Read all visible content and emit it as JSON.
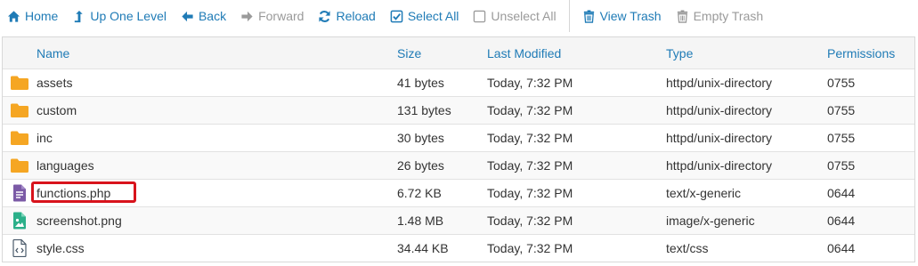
{
  "toolbar": {
    "home": "Home",
    "up_one_level": "Up One Level",
    "back": "Back",
    "forward": "Forward",
    "reload": "Reload",
    "select_all": "Select All",
    "unselect_all": "Unselect All",
    "view_trash": "View Trash",
    "empty_trash": "Empty Trash"
  },
  "table": {
    "headers": {
      "name": "Name",
      "size": "Size",
      "modified": "Last Modified",
      "type": "Type",
      "permissions": "Permissions"
    },
    "rows": [
      {
        "icon": "folder-icon",
        "name": "assets",
        "size": "41 bytes",
        "modified": "Today, 7:32 PM",
        "type": "httpd/unix-directory",
        "perm": "0755"
      },
      {
        "icon": "folder-icon",
        "name": "custom",
        "size": "131 bytes",
        "modified": "Today, 7:32 PM",
        "type": "httpd/unix-directory",
        "perm": "0755"
      },
      {
        "icon": "folder-icon",
        "name": "inc",
        "size": "30 bytes",
        "modified": "Today, 7:32 PM",
        "type": "httpd/unix-directory",
        "perm": "0755"
      },
      {
        "icon": "folder-icon",
        "name": "languages",
        "size": "26 bytes",
        "modified": "Today, 7:32 PM",
        "type": "httpd/unix-directory",
        "perm": "0755"
      },
      {
        "icon": "text-file-icon",
        "name": "functions.php",
        "size": "6.72 KB",
        "modified": "Today, 7:32 PM",
        "type": "text/x-generic",
        "perm": "0644"
      },
      {
        "icon": "image-file-icon",
        "name": "screenshot.png",
        "size": "1.48 MB",
        "modified": "Today, 7:32 PM",
        "type": "image/x-generic",
        "perm": "0644"
      },
      {
        "icon": "code-file-icon",
        "name": "style.css",
        "size": "34.44 KB",
        "modified": "Today, 7:32 PM",
        "type": "text/css",
        "perm": "0644"
      }
    ]
  },
  "colors": {
    "link": "#1f7bb6",
    "disabled": "#9a9a9a",
    "folder": "#f5a623",
    "text_file": "#7b5aa6",
    "image_file": "#2bb08a",
    "code_file": "#4a5a6a",
    "highlight": "#d8131c"
  }
}
